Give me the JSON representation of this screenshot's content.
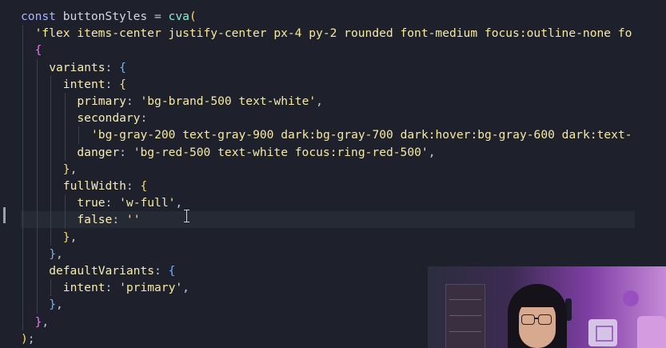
{
  "editor": {
    "lines": [
      {
        "indent": 0,
        "tokens": [
          [
            "kw",
            "const "
          ],
          [
            "def",
            "buttonStyles "
          ],
          [
            "punc",
            "= "
          ],
          [
            "fn",
            "cva"
          ],
          [
            "b1",
            "("
          ]
        ]
      },
      {
        "indent": 1,
        "tokens": [
          [
            "str",
            "'flex items-center justify-center px-4 py-2 rounded font-medium focus:outline-none fo"
          ]
        ]
      },
      {
        "indent": 1,
        "tokens": [
          [
            "b2",
            "{"
          ]
        ]
      },
      {
        "indent": 2,
        "tokens": [
          [
            "prop",
            "variants"
          ],
          [
            "punc",
            ": "
          ],
          [
            "b3",
            "{"
          ]
        ]
      },
      {
        "indent": 3,
        "tokens": [
          [
            "prop",
            "intent"
          ],
          [
            "punc",
            ": "
          ],
          [
            "b1",
            "{"
          ]
        ]
      },
      {
        "indent": 4,
        "tokens": [
          [
            "prop",
            "primary"
          ],
          [
            "punc",
            ": "
          ],
          [
            "str",
            "'bg-brand-500 text-white'"
          ],
          [
            "punc",
            ","
          ]
        ]
      },
      {
        "indent": 4,
        "tokens": [
          [
            "prop",
            "secondary"
          ],
          [
            "punc",
            ":"
          ]
        ]
      },
      {
        "indent": 5,
        "tokens": [
          [
            "str",
            "'bg-gray-200 text-gray-900 dark:bg-gray-700 dark:hover:bg-gray-600 dark:text-"
          ]
        ]
      },
      {
        "indent": 4,
        "tokens": [
          [
            "prop",
            "danger"
          ],
          [
            "punc",
            ": "
          ],
          [
            "str",
            "'bg-red-500 text-white focus:ring-red-500'"
          ],
          [
            "punc",
            ","
          ]
        ]
      },
      {
        "indent": 3,
        "tokens": [
          [
            "b1",
            "}"
          ],
          [
            "punc",
            ","
          ]
        ]
      },
      {
        "indent": 3,
        "tokens": [
          [
            "prop",
            "fullWidth"
          ],
          [
            "punc",
            ": "
          ],
          [
            "b1",
            "{"
          ]
        ]
      },
      {
        "indent": 4,
        "tokens": [
          [
            "prop",
            "true"
          ],
          [
            "punc",
            ": "
          ],
          [
            "str",
            "'w-full'"
          ],
          [
            "punc",
            ","
          ]
        ]
      },
      {
        "indent": 4,
        "current": true,
        "tokens": [
          [
            "prop",
            "false"
          ],
          [
            "punc",
            ": "
          ],
          [
            "str",
            "''"
          ]
        ]
      },
      {
        "indent": 3,
        "tokens": [
          [
            "b1",
            "}"
          ],
          [
            "punc",
            ","
          ]
        ]
      },
      {
        "indent": 2,
        "tokens": [
          [
            "b3",
            "}"
          ],
          [
            "punc",
            ","
          ]
        ]
      },
      {
        "indent": 2,
        "tokens": [
          [
            "prop",
            "defaultVariants"
          ],
          [
            "punc",
            ": "
          ],
          [
            "b3",
            "{"
          ]
        ]
      },
      {
        "indent": 3,
        "tokens": [
          [
            "prop",
            "intent"
          ],
          [
            "punc",
            ": "
          ],
          [
            "str",
            "'primary'"
          ],
          [
            "punc",
            ","
          ]
        ]
      },
      {
        "indent": 2,
        "tokens": [
          [
            "b3",
            "}"
          ],
          [
            "punc",
            ","
          ]
        ]
      },
      {
        "indent": 1,
        "tokens": [
          [
            "b2",
            "}"
          ],
          [
            "punc",
            ","
          ]
        ]
      },
      {
        "indent": 0,
        "tokens": [
          [
            "b1",
            ")"
          ],
          [
            "punc",
            ";"
          ]
        ]
      }
    ]
  },
  "webcam": {
    "present": true,
    "content": "streamer-webcam-overlay"
  },
  "colors": {
    "background": "#1e212b",
    "keyword": "#a7b6ff",
    "function": "#8fe9d7",
    "string": "#f6e9a0",
    "property": "#f7ecb4"
  },
  "icons": [
    "text-cursor-icon"
  ]
}
